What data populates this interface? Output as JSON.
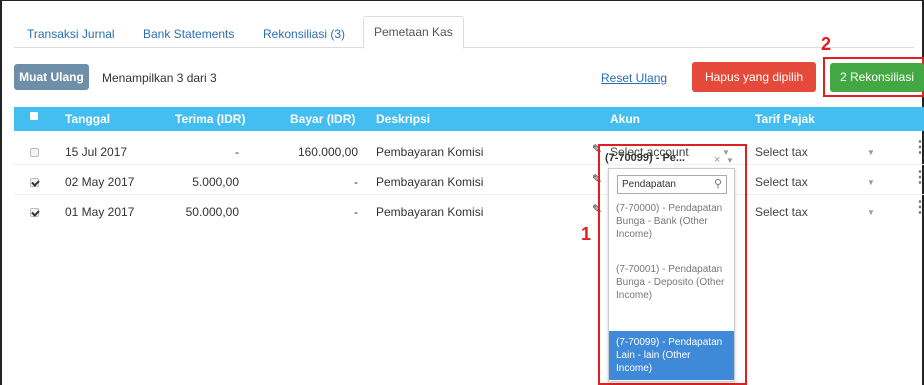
{
  "tabs": [
    "Transaksi Jurnal",
    "Bank Statements",
    "Rekonsiliasi (3)",
    "Pemetaan Kas"
  ],
  "toolbar": {
    "reload": "Muat Ulang",
    "showing": "Menampilkan 3 dari 3",
    "reset": "Reset Ulang",
    "delete": "Hapus yang dipilih",
    "reconcile": "2 Rekonsiliasi"
  },
  "callouts": {
    "one": "1",
    "two": "2"
  },
  "columns": {
    "date": "Tanggal",
    "receive": "Terima (IDR)",
    "pay": "Bayar (IDR)",
    "desc": "Deskripsi",
    "account": "Akun",
    "tax": "Tarif Pajak"
  },
  "rows": [
    {
      "date": "15 Jul 2017",
      "receive": "-",
      "pay": "160.000,00",
      "desc": "Pembayaran Komisi",
      "account": "Select account",
      "tax": "Select tax",
      "checked": false
    },
    {
      "date": "02 May 2017",
      "receive": "5.000,00",
      "pay": "-",
      "desc": "Pembayaran Komisi",
      "account": "(7-70099) - Pe...",
      "tax": "Select tax",
      "checked": true
    },
    {
      "date": "01 May 2017",
      "receive": "50.000,00",
      "pay": "-",
      "desc": "Pembayaran Komisi",
      "account": "",
      "tax": "Select tax",
      "checked": true
    }
  ],
  "dropdown": {
    "search_value": "Pendapatan",
    "clear": "×",
    "options": [
      "(7-70000) - Pendapatan Bunga - Bank (Other Income)",
      "(7-70001) - Pendapatan Bunga - Deposito (Other Income)",
      "(7-70099) - Pendapatan Lain - lain (Other Income)"
    ],
    "highlighted_index": 2
  },
  "icons": {
    "pencil": "pencil-icon",
    "search": "search-icon",
    "kebab": "kebab-menu-icon",
    "caret": "caret-down-icon",
    "check": "check-icon"
  },
  "colors": {
    "header": "#44bdf0",
    "reload": "#6d90a8",
    "delete": "#e4493a",
    "reconcile": "#43a843",
    "highlight": "#3f89d9",
    "callout": "#e02020"
  }
}
